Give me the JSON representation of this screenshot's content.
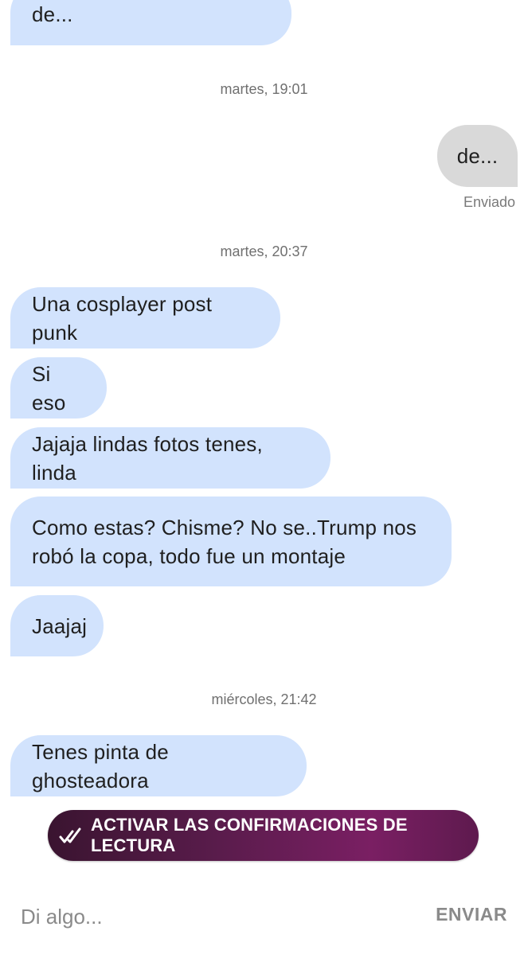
{
  "conversation": {
    "messages": [
      {
        "dir": "in",
        "text": "Hermosa, tenes pinta de..."
      },
      {
        "dir": "out",
        "text": "de..."
      },
      {
        "dir": "in",
        "text": "Una cosplayer post punk"
      },
      {
        "dir": "in",
        "text": "Si eso"
      },
      {
        "dir": "in",
        "text": "Jajaja lindas fotos tenes, linda"
      },
      {
        "dir": "in",
        "text": "Como estas? Chisme? No se..Trump nos robó la copa, todo fue un montaje"
      },
      {
        "dir": "in",
        "text": "Jaajaj"
      },
      {
        "dir": "in",
        "text": "Tenes pinta de ghosteadora"
      }
    ],
    "timestamps": [
      "martes, 19:01",
      "martes, 20:37",
      "miércoles, 21:42"
    ],
    "sent_status": "Enviado"
  },
  "read_receipts_banner": {
    "label": "ACTIVAR LAS CONFIRMACIONES DE LECTURA",
    "icon": "double-check-icon"
  },
  "composer": {
    "placeholder": "Di algo...",
    "value": "",
    "send_label": "ENVIAR"
  },
  "colors": {
    "incoming_bubble": "#d2e3fd",
    "outgoing_bubble": "#d9d9d9",
    "banner_gradient_start": "#3a1430",
    "banner_gradient_end": "#7a1f63"
  }
}
